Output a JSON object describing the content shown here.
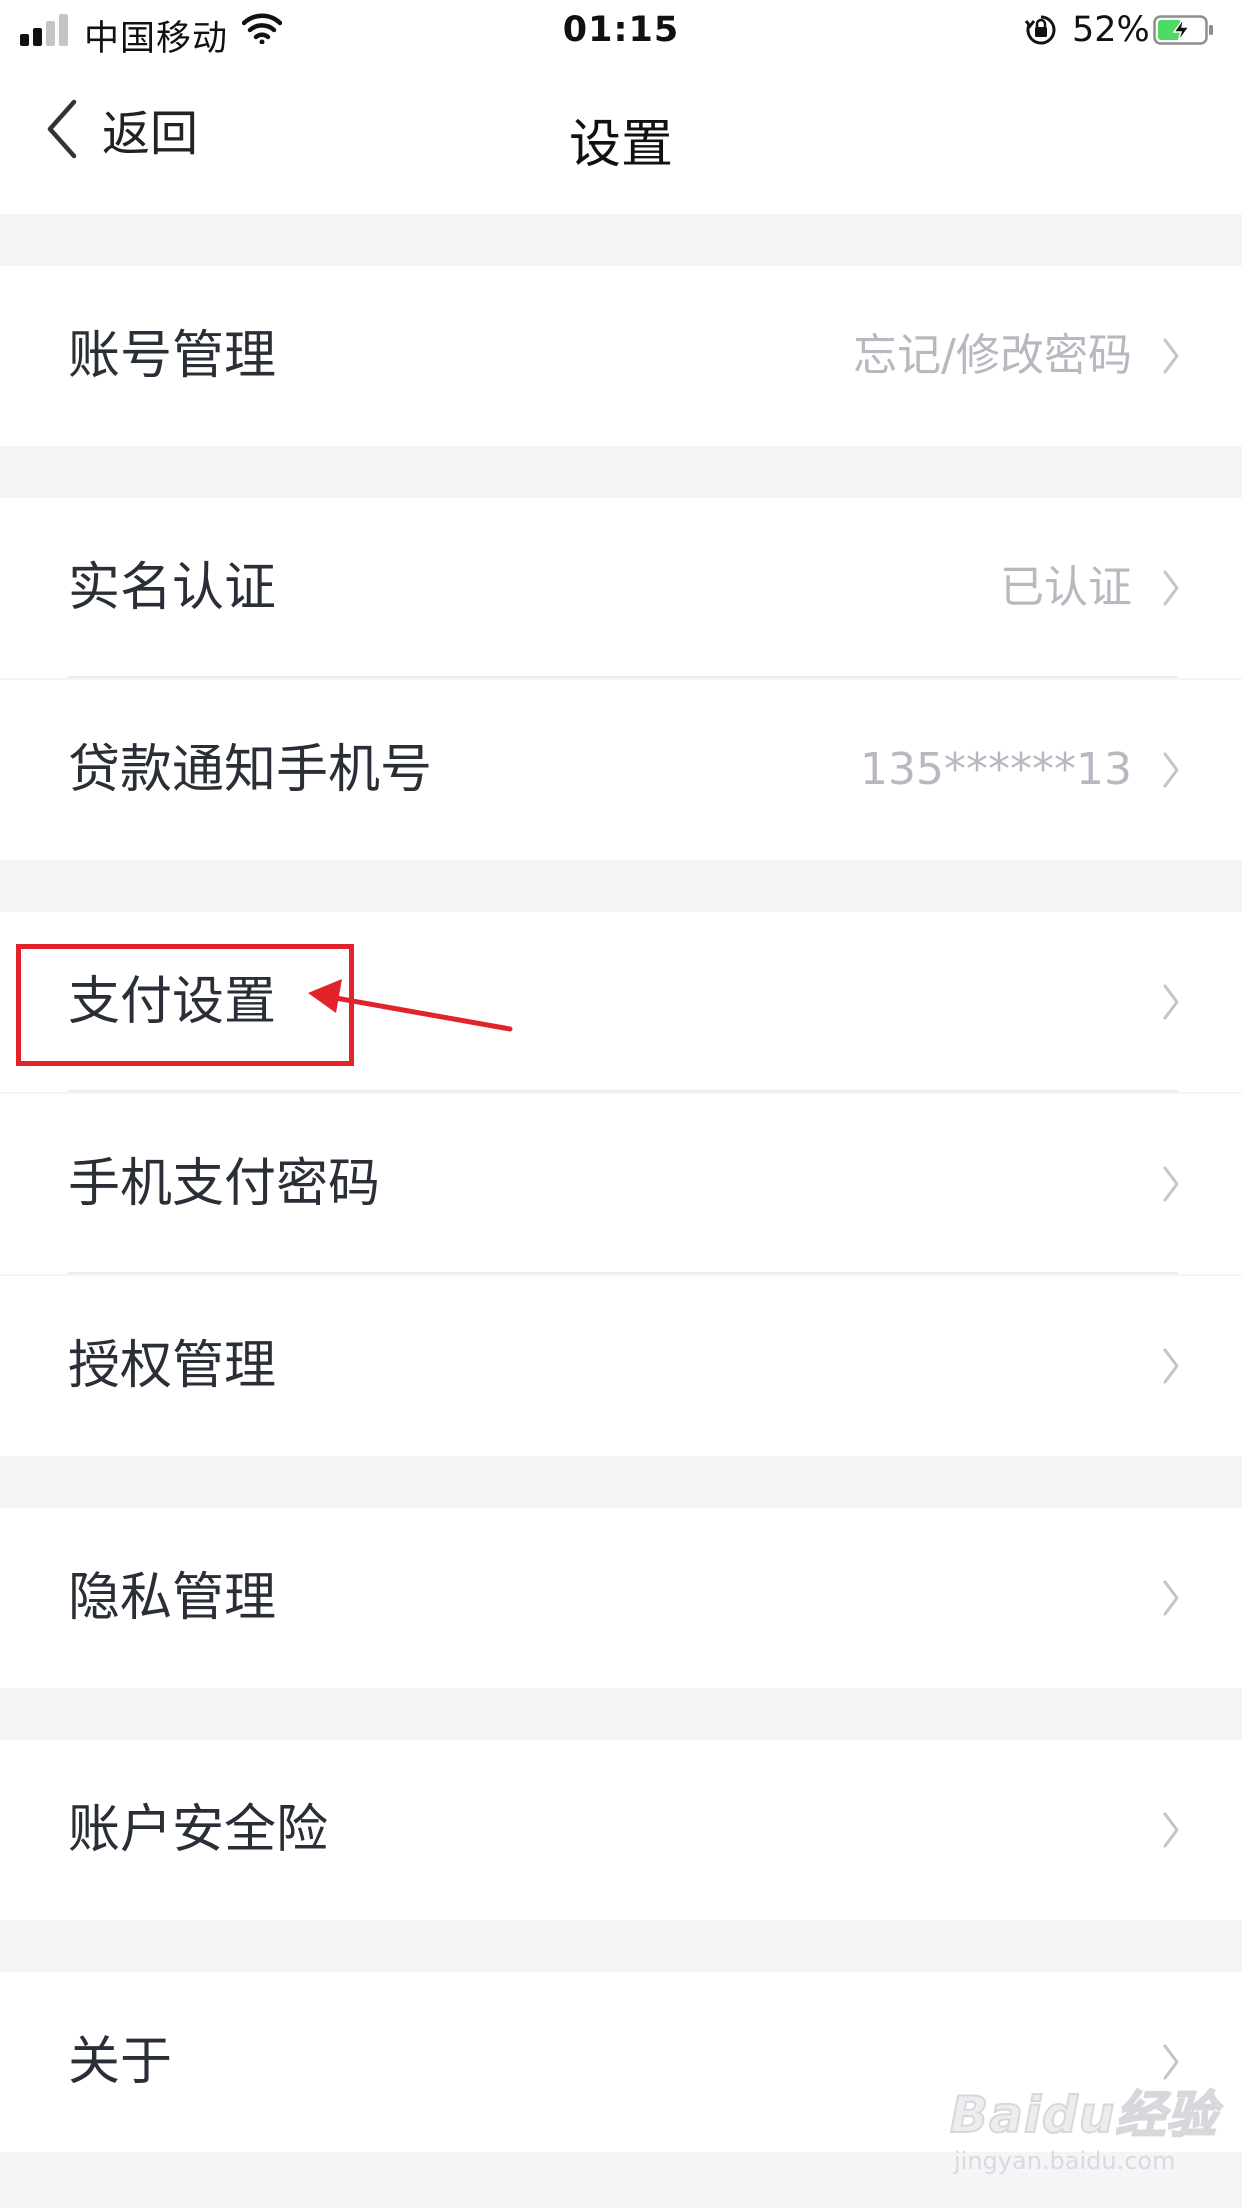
{
  "status_bar": {
    "carrier": "中国移动",
    "time": "01:15",
    "battery_percent": "52%",
    "battery_level": 0.52,
    "signal_bars": 2,
    "battery_charging": true,
    "battery_color": "#4cd964"
  },
  "nav": {
    "back_label": "返回",
    "title": "设置"
  },
  "settings": {
    "account_management": {
      "label": "账号管理",
      "value": "忘记/修改密码"
    },
    "real_name": {
      "label": "实名认证",
      "value": "已认证"
    },
    "loan_phone": {
      "label": "贷款通知手机号",
      "value": "135******13"
    },
    "payment_settings": {
      "label": "支付设置"
    },
    "mobile_pay_password": {
      "label": "手机支付密码"
    },
    "authorization": {
      "label": "授权管理"
    },
    "privacy": {
      "label": "隐私管理"
    },
    "account_insurance": {
      "label": "账户安全险"
    },
    "about": {
      "label": "关于"
    }
  },
  "annotation": {
    "color": "#e3232c",
    "highlighted_item": "支付设置"
  },
  "watermark": {
    "brand": "Baidu经验",
    "url": "jingyan.baidu.com"
  },
  "colors": {
    "page_background": "#f4f5f7",
    "row_background": "#ffffff",
    "label_text": "#2a2f37",
    "value_text": "#b6b9c0"
  }
}
